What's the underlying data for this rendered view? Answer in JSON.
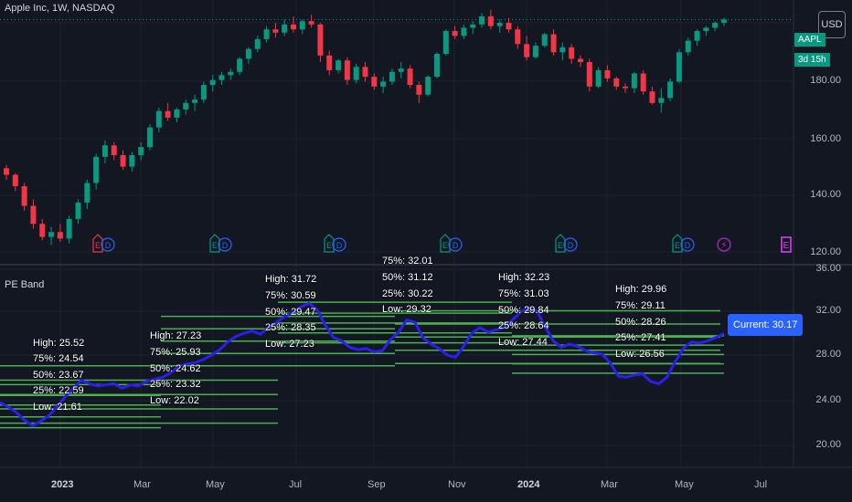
{
  "header": {
    "title": "Apple Inc, 1W, NASDAQ",
    "currency": "USD",
    "ticker_tag": "AAPL",
    "countdown": "3d 15h"
  },
  "indicator": {
    "name": "PE Band",
    "current_label": "Current: 30.17"
  },
  "colors": {
    "up": "#089981",
    "down": "#f23645",
    "pe_line": "#2b1ef0",
    "band": "#4caf50",
    "bg": "#131722"
  },
  "price_axis": {
    "ticks": [
      "180.00",
      "160.00",
      "140.00",
      "120.00"
    ]
  },
  "pe_axis": {
    "ticks": [
      "36.00",
      "32.00",
      "28.00",
      "24.00",
      "20.00"
    ]
  },
  "x_axis": {
    "ticks": [
      "2023",
      "Mar",
      "May",
      "Jul",
      "Sep",
      "Nov",
      "2024",
      "Mar",
      "May",
      "Jul"
    ]
  },
  "event_markers": [
    "E",
    "E",
    "E",
    "E",
    "E",
    "E",
    "E",
    "E"
  ],
  "chart_data": [
    {
      "type": "candlestick",
      "title": "Apple Inc, 1W, NASDAQ",
      "ylim": [
        118,
        192
      ],
      "candles": [
        [
          147.5,
          148.5,
          144.0,
          145.5
        ],
        [
          145.5,
          146.0,
          140.5,
          142.0
        ],
        [
          142.0,
          143.0,
          134.5,
          136.0
        ],
        [
          136.0,
          138.0,
          129.0,
          130.5
        ],
        [
          130.5,
          132.0,
          125.5,
          126.5
        ],
        [
          126.5,
          129.5,
          124.0,
          128.0
        ],
        [
          128.0,
          130.5,
          125.0,
          126.0
        ],
        [
          126.0,
          133.0,
          124.5,
          132.0
        ],
        [
          132.0,
          138.0,
          130.5,
          137.0
        ],
        [
          137.0,
          144.0,
          135.0,
          143.0
        ],
        [
          143.0,
          152.0,
          141.0,
          151.0
        ],
        [
          151.0,
          156.0,
          149.0,
          154.5
        ],
        [
          154.5,
          155.5,
          150.0,
          151.5
        ],
        [
          151.5,
          153.0,
          147.0,
          148.0
        ],
        [
          148.0,
          152.5,
          146.5,
          151.5
        ],
        [
          151.5,
          155.5,
          150.0,
          154.0
        ],
        [
          154.0,
          161.0,
          153.0,
          160.0
        ],
        [
          160.0,
          166.0,
          158.5,
          165.0
        ],
        [
          165.0,
          167.5,
          162.0,
          163.0
        ],
        [
          163.0,
          166.0,
          161.5,
          165.5
        ],
        [
          165.5,
          168.5,
          164.0,
          167.5
        ],
        [
          167.5,
          170.0,
          165.0,
          168.5
        ],
        [
          168.5,
          174.0,
          167.5,
          173.0
        ],
        [
          173.0,
          176.0,
          171.0,
          174.5
        ],
        [
          174.5,
          177.0,
          173.0,
          176.0
        ],
        [
          176.0,
          178.0,
          174.5,
          177.0
        ],
        [
          177.0,
          181.5,
          176.0,
          181.0
        ],
        [
          181.0,
          184.5,
          179.5,
          184.0
        ],
        [
          184.0,
          188.0,
          183.0,
          187.0
        ],
        [
          187.0,
          191.0,
          186.0,
          190.0
        ],
        [
          190.0,
          192.0,
          187.5,
          189.0
        ],
        [
          189.0,
          193.0,
          188.0,
          191.5
        ],
        [
          191.5,
          194.0,
          189.0,
          190.0
        ],
        [
          190.0,
          193.0,
          188.5,
          192.5
        ],
        [
          192.5,
          194.5,
          190.5,
          191.5
        ],
        [
          191.5,
          192.0,
          180.0,
          182.0
        ],
        [
          182.0,
          183.5,
          176.0,
          177.5
        ],
        [
          177.5,
          181.0,
          176.5,
          180.5
        ],
        [
          180.5,
          181.5,
          173.0,
          174.5
        ],
        [
          174.5,
          179.5,
          173.5,
          178.5
        ],
        [
          178.5,
          180.0,
          174.0,
          175.5
        ],
        [
          175.5,
          176.5,
          171.5,
          172.5
        ],
        [
          172.5,
          175.5,
          170.5,
          174.0
        ],
        [
          174.0,
          178.0,
          173.0,
          177.0
        ],
        [
          177.0,
          180.0,
          175.0,
          178.0
        ],
        [
          178.0,
          179.0,
          172.0,
          173.0
        ],
        [
          173.0,
          174.0,
          167.5,
          170.0
        ],
        [
          170.0,
          176.0,
          169.5,
          175.5
        ],
        [
          175.5,
          183.0,
          175.0,
          182.5
        ],
        [
          182.5,
          190.0,
          182.0,
          189.5
        ],
        [
          189.5,
          191.0,
          187.0,
          188.0
        ],
        [
          188.0,
          191.5,
          187.0,
          190.5
        ],
        [
          190.5,
          192.5,
          188.5,
          191.5
        ],
        [
          191.5,
          195.0,
          190.5,
          194.0
        ],
        [
          194.0,
          196.0,
          190.0,
          191.0
        ],
        [
          191.0,
          193.0,
          189.0,
          192.0
        ],
        [
          192.0,
          193.5,
          189.0,
          190.0
        ],
        [
          190.0,
          191.0,
          184.0,
          185.5
        ],
        [
          185.5,
          188.0,
          180.5,
          181.5
        ],
        [
          181.5,
          186.0,
          181.0,
          185.0
        ],
        [
          185.0,
          189.0,
          184.5,
          188.5
        ],
        [
          188.5,
          190.0,
          182.0,
          183.0
        ],
        [
          183.0,
          186.0,
          180.5,
          184.5
        ],
        [
          184.5,
          185.5,
          179.5,
          181.0
        ],
        [
          181.0,
          182.0,
          178.5,
          180.0
        ],
        [
          180.0,
          181.0,
          171.0,
          172.5
        ],
        [
          172.5,
          178.5,
          172.0,
          177.5
        ],
        [
          177.5,
          179.0,
          174.0,
          175.0
        ],
        [
          175.0,
          175.5,
          171.5,
          172.5
        ],
        [
          172.5,
          173.5,
          170.5,
          172.0
        ],
        [
          172.0,
          177.0,
          170.5,
          176.5
        ],
        [
          176.5,
          177.5,
          170.0,
          171.0
        ],
        [
          171.0,
          172.5,
          167.0,
          167.5
        ],
        [
          167.5,
          172.0,
          164.5,
          169.0
        ],
        [
          169.0,
          175.0,
          168.0,
          174.0
        ],
        [
          174.0,
          184.0,
          173.5,
          183.0
        ],
        [
          183.0,
          187.5,
          182.0,
          186.5
        ],
        [
          186.5,
          190.0,
          185.0,
          189.5
        ],
        [
          189.5,
          191.0,
          188.0,
          190.5
        ],
        [
          190.5,
          192.5,
          189.5,
          192.0
        ],
        [
          192.0,
          193.5,
          191.0,
          193.0
        ]
      ]
    },
    {
      "type": "line",
      "title": "PE Band",
      "ylim": [
        18.5,
        36.5
      ],
      "x_labels": [
        "2023",
        "Mar",
        "May",
        "Jul",
        "Sep",
        "Nov",
        "2024",
        "Mar",
        "May",
        "Jul"
      ],
      "series": [
        {
          "name": "PE",
          "values": [
            23.9,
            23.5,
            23.0,
            22.3,
            21.8,
            22.2,
            22.7,
            23.5,
            24.4,
            25.2,
            25.9,
            25.6,
            25.4,
            25.5,
            25.6,
            25.2,
            25.5,
            25.4,
            25.8,
            26.0,
            26.2,
            26.6,
            27.2,
            27.4,
            27.5,
            27.8,
            28.2,
            28.7,
            29.4,
            29.9,
            30.2,
            30.4,
            30.1,
            30.7,
            31.2,
            31.7,
            32.1,
            32.6,
            32.9,
            32.3,
            30.9,
            29.8,
            29.5,
            28.9,
            28.7,
            28.8,
            28.5,
            28.6,
            29.6,
            30.3,
            31.4,
            31.2,
            29.8,
            29.2,
            28.8,
            28.2,
            28.0,
            29.0,
            30.2,
            30.7,
            30.3,
            30.5,
            30.7,
            31.4,
            32.1,
            32.5,
            32.2,
            30.8,
            29.5,
            28.9,
            29.2,
            29.0,
            28.6,
            28.4,
            28.3,
            27.5,
            26.3,
            26.2,
            26.4,
            26.5,
            25.8,
            25.6,
            26.2,
            27.6,
            28.8,
            29.4,
            29.3,
            29.5,
            29.8,
            30.17
          ]
        }
      ],
      "bands": [
        {
          "label_high": "High: 25.52",
          "label_75": "75%: 24.54",
          "label_50": "50%: 23.67",
          "label_25": "25%: 22.59",
          "label_low": "Low: 21.61",
          "values": [
            25.52,
            24.54,
            23.67,
            22.59,
            21.61
          ]
        },
        {
          "label_high": "High: 27.23",
          "label_75": "75%: 25.93",
          "label_50": "50%: 24.62",
          "label_25": "25%: 23.32",
          "label_low": "Low: 22.02",
          "values": [
            27.23,
            25.93,
            24.62,
            23.32,
            22.02
          ]
        },
        {
          "label_high": "High: 31.72",
          "label_75": "75%: 30.59",
          "label_50": "50%: 29.47",
          "label_25": "25%: 28.35",
          "label_low": "Low: 27.23",
          "values": [
            31.72,
            30.59,
            29.47,
            28.35,
            27.23
          ]
        },
        {
          "label_high": "",
          "label_75": "75%: 32.01",
          "label_50": "50%: 31.12",
          "label_25": "25%: 30.22",
          "label_low": "Low: 29.32",
          "values": [
            33.01,
            32.01,
            31.12,
            30.22,
            29.32
          ]
        },
        {
          "label_high": "High: 32.23",
          "label_75": "75%: 31.03",
          "label_50": "50%: 29.84",
          "label_25": "25%: 28.64",
          "label_low": "Low: 27.44",
          "values": [
            32.23,
            31.03,
            29.84,
            28.64,
            27.44
          ]
        },
        {
          "label_high": "High: 29.96",
          "label_75": "75%: 29.11",
          "label_50": "50%: 28.26",
          "label_25": "25%: 27.41",
          "label_low": "Low: 26.56",
          "values": [
            29.96,
            29.11,
            28.26,
            27.41,
            26.56
          ]
        }
      ],
      "current": 30.17
    }
  ]
}
